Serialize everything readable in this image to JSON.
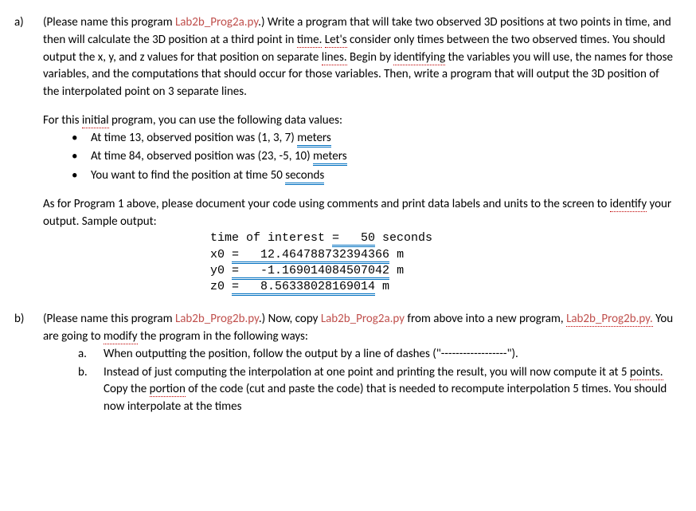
{
  "a": {
    "label": "a)",
    "intro_1": "(Please name this program ",
    "progname": "Lab2b_Prog2a.py",
    "intro_2": ".)  Write a program that will take two observed 3D positions at two points in time, and then will calculate the 3D position at a third point in ",
    "time_word": "time.",
    "lets": "Let's",
    "intro_3": " consider only times between the two observed times.  You should output the x, y, and z values for that position on separate ",
    "lines_word": "lines.",
    "intro_4": "  Begin by ",
    "identifying": "identifying",
    "intro_5": " the variables you will use, the names for those variables, and the computations that should occur for those variables.  Then, write a program that will output the 3D position of the interpolated point on 3 separate lines.",
    "forthis_1": "For this ",
    "initial": "initial",
    "forthis_2": " program, you can use the following data values:",
    "b1_1": "At time 13, observed position was (1, 3, 7) ",
    "b1_meters": "meters",
    "b2_1": "At time 84, observed position was (23, -5, 10) ",
    "b2_meters": "meters",
    "b3_1": "You want to find the position at time 50 ",
    "b3_seconds": "seconds",
    "asfor_1": "As for Program 1 above, please document your code using comments and print data labels and units to the screen to ",
    "identify": "identify",
    "asfor_2": " your output.  Sample output:",
    "out_line1a": "time of interest ",
    "out_line1b": "=   50",
    "out_line1c": " seconds",
    "out_line2a": "x0 ",
    "out_line2b": "=   12.464788732394366",
    "out_line2c": " m",
    "out_line3a": "y0 ",
    "out_line3b": "=   -1.169014084507042",
    "out_line3c": " m",
    "out_line4a": "z0 ",
    "out_line4b": "=   8.56338028169014",
    "out_line4c": " m"
  },
  "b": {
    "label": "b)",
    "intro_1": "(Please name this program ",
    "progname1": "Lab2b_Prog2b.py",
    "intro_2": ".)  Now, copy ",
    "progname2": "Lab2b_Prog2a.py",
    "intro_3": " from above into a new program, ",
    "progname3": "Lab2b_Prog2b.py.",
    "intro_4": "  You are going to ",
    "modify": "modify",
    "intro_5": " the program in the following ways:",
    "sa_label": "a.",
    "sa_text": "When outputting the position, follow the output by a line of dashes (\"------------------\").",
    "sb_label": "b.",
    "sb_1": "Instead of just computing the interpolation at one point and printing the result, you will now compute it at 5 ",
    "points_word": "points.",
    "sb_2": "  Copy the ",
    "portion": "portion",
    "sb_3": " of the code (cut and paste the code) that is needed to recompute interpolation 5 times.  You should now interpolate at the times"
  },
  "bullet": "•"
}
